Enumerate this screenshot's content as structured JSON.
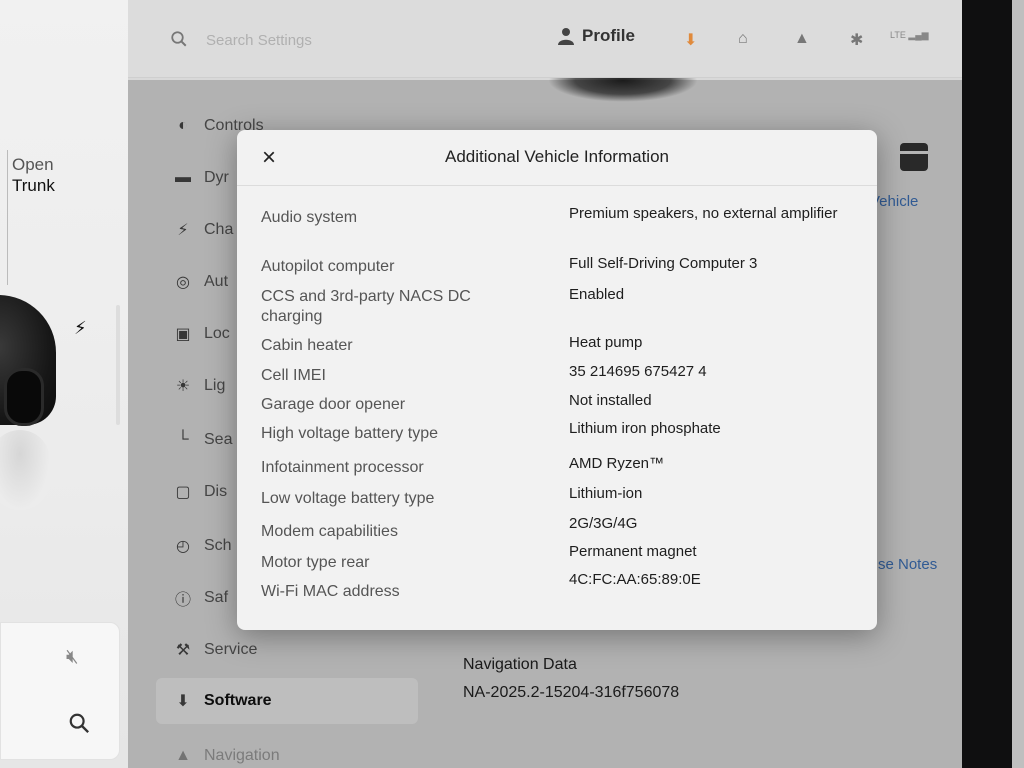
{
  "car_panel": {
    "open_label": "Open",
    "trunk_label": "Trunk"
  },
  "search": {
    "placeholder": "Search Settings"
  },
  "header": {
    "profile_label": "Profile",
    "lte_label": "LTE"
  },
  "menu": {
    "items": [
      {
        "label": "Controls",
        "icon": "toggle-icon"
      },
      {
        "label": "Dyr",
        "icon": "car-icon"
      },
      {
        "label": "Cha",
        "icon": "bolt-icon"
      },
      {
        "label": "Aut",
        "icon": "steering-wheel-icon"
      },
      {
        "label": "Loc",
        "icon": "lock-icon"
      },
      {
        "label": "Lig",
        "icon": "light-icon"
      },
      {
        "label": "Sea",
        "icon": "seat-icon"
      },
      {
        "label": "Dis",
        "icon": "display-icon"
      },
      {
        "label": "Sch",
        "icon": "alarm-clock-icon"
      },
      {
        "label": "Saf",
        "icon": "safety-icon"
      },
      {
        "label": "Service",
        "icon": "wrench-icon"
      },
      {
        "label": "Software",
        "icon": "download-icon"
      },
      {
        "label": "Navigation",
        "icon": "navigation-icon"
      }
    ]
  },
  "right_links": {
    "vehicle": "Vehicle",
    "release_notes": "se Notes"
  },
  "navigation_data": {
    "label": "Navigation Data",
    "value": "NA-2025.2-15204-316f756078"
  },
  "modal": {
    "title": "Additional Vehicle Information",
    "close_label": "×",
    "rows": [
      {
        "key": "Audio system",
        "value": "Premium speakers, no external amplifier"
      },
      {
        "key": "Autopilot computer",
        "value": "Full Self-Driving Computer 3"
      },
      {
        "key": "CCS and 3rd-party NACS DC charging",
        "value": "Enabled"
      },
      {
        "key": "Cabin heater",
        "value": "Heat pump"
      },
      {
        "key": "Cell IMEI",
        "value": "35 214695 675427 4"
      },
      {
        "key": "Garage door opener",
        "value": "Not installed"
      },
      {
        "key": "High voltage battery type",
        "value": "Lithium iron phosphate"
      },
      {
        "key": "Infotainment processor",
        "value": "AMD Ryzen™"
      },
      {
        "key": "Low voltage battery type",
        "value": "Lithium-ion"
      },
      {
        "key": "Modem capabilities",
        "value": "2G/3G/4G"
      },
      {
        "key": "Motor type rear",
        "value": "Permanent magnet"
      },
      {
        "key": "Wi-Fi MAC address",
        "value": "4C:FC:AA:65:89:0E"
      }
    ]
  }
}
